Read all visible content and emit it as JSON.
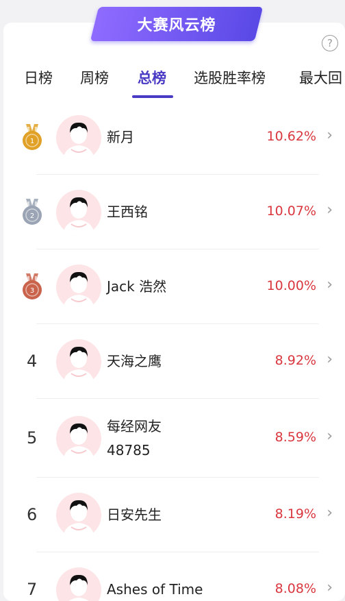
{
  "banner": {
    "title": "大赛风云榜"
  },
  "help": {
    "glyph": "?"
  },
  "tabs": [
    {
      "label": "日榜"
    },
    {
      "label": "周榜"
    },
    {
      "label": "总榜",
      "active": true
    },
    {
      "label": "选股胜率榜"
    },
    {
      "label": "最大回"
    }
  ],
  "entries": [
    {
      "rank": "1",
      "medal": "gold",
      "name_lines": [
        "新月"
      ],
      "pct": "10.62%"
    },
    {
      "rank": "2",
      "medal": "silver",
      "name_lines": [
        "王西铭"
      ],
      "pct": "10.07%"
    },
    {
      "rank": "3",
      "medal": "bronze",
      "name_lines": [
        "Jack 浩然"
      ],
      "pct": "10.00%"
    },
    {
      "rank": "4",
      "medal": null,
      "name_lines": [
        "天海之鹰"
      ],
      "pct": "8.92%"
    },
    {
      "rank": "5",
      "medal": null,
      "name_lines": [
        "每经网友",
        "48785"
      ],
      "pct": "8.59%"
    },
    {
      "rank": "6",
      "medal": null,
      "name_lines": [
        "日安先生"
      ],
      "pct": "8.19%"
    },
    {
      "rank": "7",
      "medal": null,
      "name_lines": [
        "Ashes of Time"
      ],
      "pct": "8.08%"
    }
  ],
  "colors": {
    "accent": "#4a3bc4",
    "gain": "#d9363e",
    "gold": "#e0a126",
    "silver": "#9aa4b4",
    "bronze": "#c9634b"
  },
  "chevron": "›"
}
